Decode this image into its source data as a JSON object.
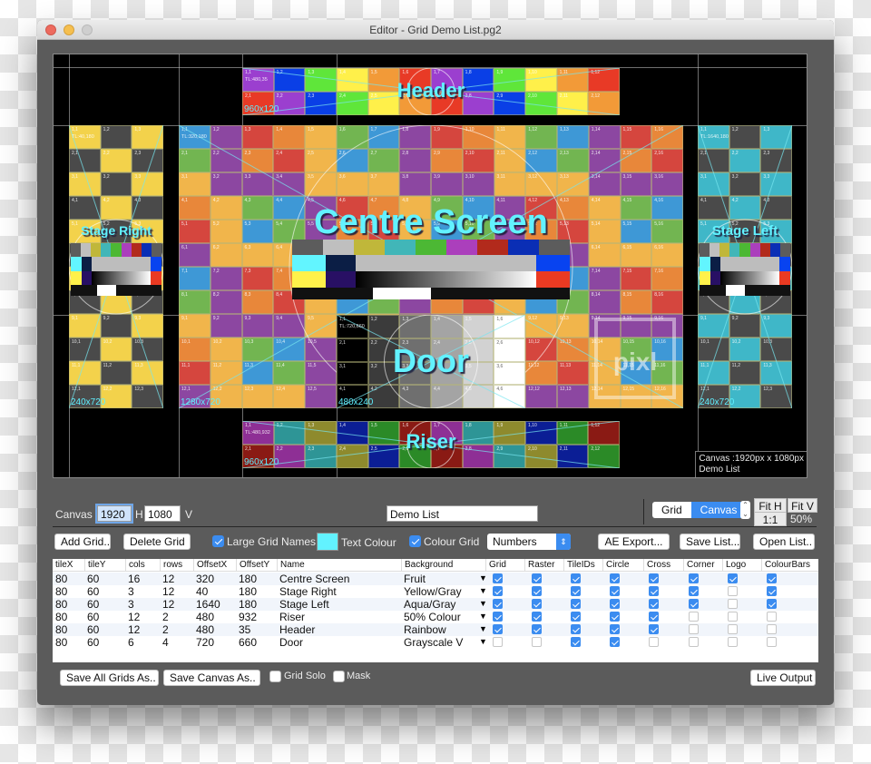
{
  "window": {
    "title": "Editor - Grid Demo List.pg2"
  },
  "preview": {
    "canvas_info_line1": "Canvas :1920px x 1080px",
    "canvas_info_line2": "Demo List",
    "logo_text": "pixl",
    "grids": [
      {
        "id": "header",
        "name": "Header",
        "tl": "TL:480,35",
        "size": "960x120",
        "cols": 12,
        "rows": 2,
        "palette": [
          "#9b3fcf",
          "#0a3fe6",
          "#5fe63a",
          "#fff04a",
          "#f29a38",
          "#e83a26"
        ],
        "pattern": "rainbow"
      },
      {
        "id": "stage-right",
        "name": "Stage Right",
        "tl": "TL:40,180",
        "size": "240x720",
        "cols": 3,
        "rows": 12,
        "palette": [
          "#f3d24b",
          "#4a4a4a"
        ],
        "pattern": "checker"
      },
      {
        "id": "centre-screen",
        "name": "Centre Screen",
        "tl": "TL:320,180",
        "size": "1280x720",
        "cols": 16,
        "rows": 12,
        "palette": [
          "#3e98d6",
          "#8c47a1",
          "#d5463e",
          "#e8873a",
          "#f1b54b",
          "#72b551"
        ],
        "pattern": "fruit"
      },
      {
        "id": "stage-left",
        "name": "Stage Left",
        "tl": "TL:1640,180",
        "size": "240x720",
        "cols": 3,
        "rows": 12,
        "palette": [
          "#3fb7c8",
          "#4a4a4a"
        ],
        "pattern": "checker"
      },
      {
        "id": "door",
        "name": "Door",
        "tl": "TL:720,660",
        "size": "480x240",
        "cols": 6,
        "rows": 4,
        "palette": [
          "#000000",
          "#3b3b3b",
          "#6f6f6f",
          "#a4a4a4",
          "#d2d2d2",
          "#ffffff"
        ],
        "pattern": "grayscale"
      },
      {
        "id": "riser",
        "name": "Riser",
        "tl": "TL:480,932",
        "size": "960x120",
        "cols": 12,
        "rows": 2,
        "palette": [
          "#8e2f95",
          "#2e9596",
          "#8e8a2d",
          "#0b1e95",
          "#2b8a27",
          "#8a1a14"
        ],
        "pattern": "half"
      }
    ],
    "colour_bars": {
      "top": [
        "#5c5c5c",
        "#bfbfbf",
        "#c0b73a",
        "#41b6b8",
        "#4cb834",
        "#ab3fbc",
        "#b22a1c",
        "#0a2eb5",
        "#5c5c5c"
      ],
      "left_mid": [
        "#62f5ff",
        "#fff14a"
      ],
      "left_dark": [
        "#0b1e45",
        "#281064"
      ],
      "right_mid": [
        "#0843f0",
        "#ea3a22"
      ]
    }
  },
  "controls": {
    "canvas_label": "Canvas",
    "canvas_width": "1920",
    "h_label": "H",
    "canvas_height": "1080",
    "v_label": "V",
    "list_name": "Demo List",
    "view_segment": [
      "Grid",
      "Canvas"
    ],
    "view_selected": "Canvas",
    "fit_h": "Fit H",
    "fit_v": "Fit V",
    "one_to_one": "1:1",
    "zoom_level": "50%",
    "add_grid": "Add Grid..",
    "delete_grid": "Delete Grid",
    "large_grid_names": {
      "label": "Large Grid Names",
      "checked": true
    },
    "text_colour": {
      "label": "Text Colour",
      "color": "#62f2ff"
    },
    "colour_grid": {
      "label": "Colour Grid",
      "checked": true
    },
    "label_mode": "Numbers",
    "ae_export": "AE Export...",
    "save_list": "Save List...",
    "open_list": "Open List.."
  },
  "table": {
    "columns": [
      "tileX",
      "tileY",
      "cols",
      "rows",
      "OffsetX",
      "OffsetY",
      "Name",
      "Background",
      "Grid",
      "Raster",
      "TileIDs",
      "Circle",
      "Cross",
      "Corner",
      "Logo",
      "ColourBars"
    ],
    "rows": [
      {
        "tileX": "80",
        "tileY": "60",
        "cols": "16",
        "rows": "12",
        "offsetX": "320",
        "offsetY": "180",
        "name": "Centre Screen",
        "background": "Fruit",
        "checks": [
          true,
          true,
          true,
          true,
          true,
          true,
          true,
          true
        ]
      },
      {
        "tileX": "80",
        "tileY": "60",
        "cols": "3",
        "rows": "12",
        "offsetX": "40",
        "offsetY": "180",
        "name": "Stage Right",
        "background": "Yellow/Gray",
        "checks": [
          true,
          true,
          true,
          true,
          true,
          true,
          false,
          true
        ]
      },
      {
        "tileX": "80",
        "tileY": "60",
        "cols": "3",
        "rows": "12",
        "offsetX": "1640",
        "offsetY": "180",
        "name": "Stage Left",
        "background": "Aqua/Gray",
        "checks": [
          true,
          true,
          true,
          true,
          true,
          true,
          false,
          true
        ]
      },
      {
        "tileX": "80",
        "tileY": "60",
        "cols": "12",
        "rows": "2",
        "offsetX": "480",
        "offsetY": "932",
        "name": "Riser",
        "background": "50% Colour",
        "checks": [
          true,
          true,
          true,
          true,
          true,
          false,
          false,
          false
        ]
      },
      {
        "tileX": "80",
        "tileY": "60",
        "cols": "12",
        "rows": "2",
        "offsetX": "480",
        "offsetY": "35",
        "name": "Header",
        "background": "Rainbow",
        "checks": [
          true,
          true,
          true,
          true,
          true,
          false,
          false,
          false
        ]
      },
      {
        "tileX": "80",
        "tileY": "60",
        "cols": "6",
        "rows": "4",
        "offsetX": "720",
        "offsetY": "660",
        "name": "Door",
        "background": "Grayscale V",
        "checks": [
          false,
          false,
          true,
          true,
          false,
          false,
          false,
          false
        ]
      }
    ]
  },
  "footer": {
    "save_all_grids": "Save All Grids As..",
    "save_canvas": "Save Canvas As..",
    "grid_solo": {
      "label": "Grid Solo",
      "checked": false
    },
    "mask": {
      "label": "Mask",
      "checked": false
    },
    "live_output": "Live Output"
  }
}
